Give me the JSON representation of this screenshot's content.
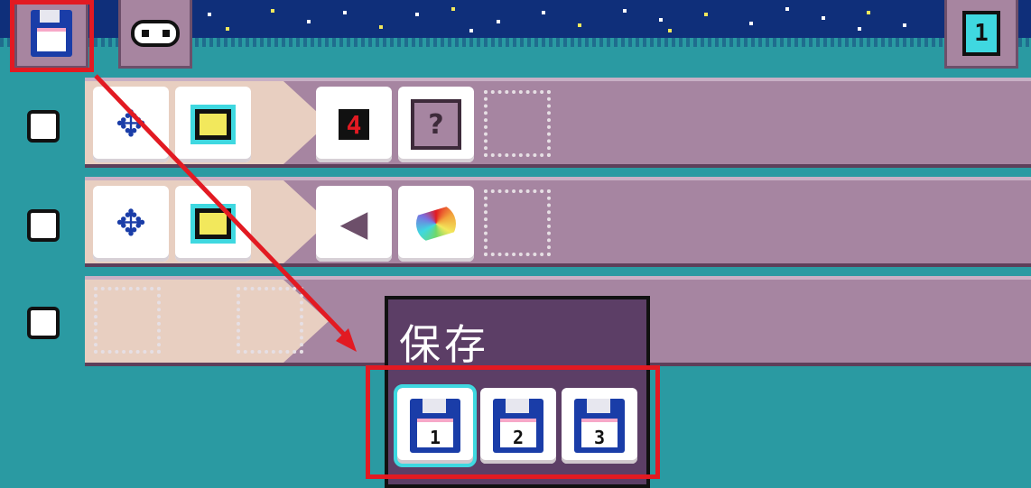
{
  "toolbar": {
    "save_icon": "floppy-disk-icon",
    "robot_icon": "robot-face-icon",
    "page_icon": "page-number-icon",
    "page_number": "1"
  },
  "rows": [
    {
      "icons": [
        "move-robot-icon",
        "signal-screen-icon",
        "counter-4-icon",
        "mystery-box-icon"
      ],
      "counter": "4",
      "mystery": "?"
    },
    {
      "icons": [
        "move-robot-icon",
        "signal-screen-icon",
        "speaker-sound-icon",
        "rainbow-squiggle-icon"
      ]
    },
    {
      "icons": []
    }
  ],
  "popup": {
    "title": "保存",
    "slots": [
      "1",
      "2",
      "3"
    ]
  },
  "colors": {
    "highlight": "#e21a22",
    "background": "#2a9aa2",
    "row": "#a685a1",
    "popup": "#5c3e66"
  }
}
